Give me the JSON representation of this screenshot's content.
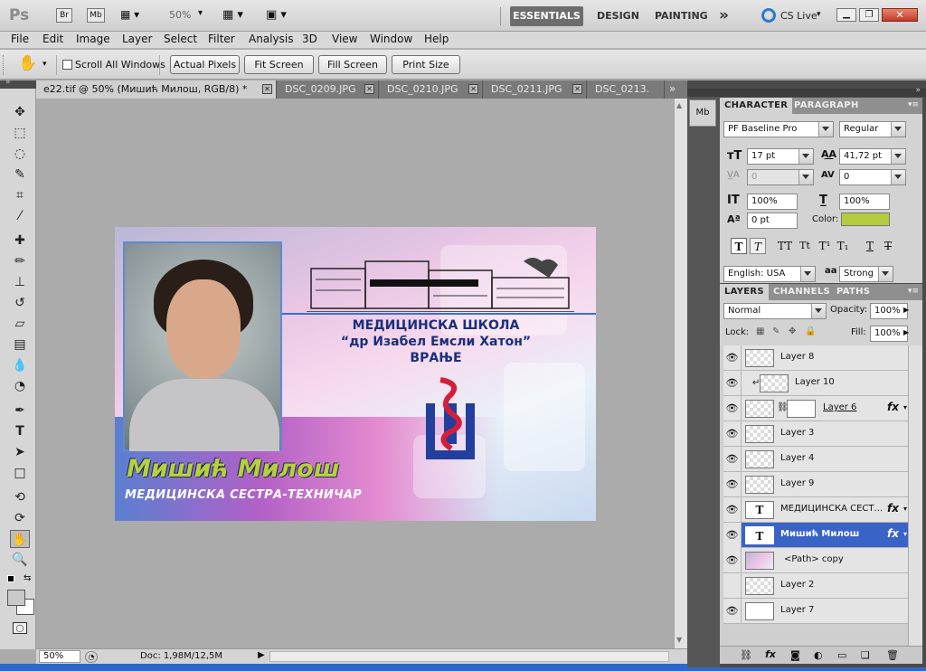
{
  "appbar": {
    "logo": "Ps",
    "bridge": "Br",
    "minibridge": "Mb",
    "zoom": "50%",
    "workspaces": [
      "ESSENTIALS",
      "DESIGN",
      "PAINTING"
    ],
    "more": "»",
    "cslive": "CS Live"
  },
  "menu": [
    "File",
    "Edit",
    "Image",
    "Layer",
    "Select",
    "Filter",
    "Analysis",
    "3D",
    "View",
    "Window",
    "Help"
  ],
  "options": {
    "scroll_all": "Scroll All Windows",
    "buttons": [
      "Actual Pixels",
      "Fit Screen",
      "Fill Screen",
      "Print Size"
    ]
  },
  "tabs": [
    "e22.tif @ 50% (Мишић Милош, RGB/8) *",
    "DSC_0209.JPG",
    "DSC_0210.JPG",
    "DSC_0211.JPG",
    "DSC_0213."
  ],
  "document": {
    "school_line1": "МЕДИЦИНСКА ШКОЛА",
    "school_line2": "“др Изабел Емсли Хатон”",
    "school_line3": "ВРАЊЕ",
    "name": "Мишић Милош",
    "role": "МЕДИЦИНСКА СЕСТРА-ТЕХНИЧАР"
  },
  "status": {
    "zoom": "50%",
    "doc": "Doc: 1,98M/12,5M"
  },
  "character": {
    "tabs": [
      "CHARACTER",
      "PARAGRAPH"
    ],
    "font": "PF Baseline Pro",
    "style": "Regular",
    "size": "17 pt",
    "leading": "41,72 pt",
    "kerning": "0",
    "tracking": "0",
    "vscale": "100%",
    "hscale": "100%",
    "baseline": "0 pt",
    "color_label": "Color:",
    "color": "#b5cc3f",
    "language": "English: USA",
    "aa_label": "aa",
    "antialias": "Strong",
    "type_buttons": [
      "T",
      "T",
      "TT",
      "Tt",
      "T¹",
      "T₁",
      "T",
      "T"
    ]
  },
  "layers": {
    "tabs": [
      "LAYERS",
      "CHANNELS",
      "PATHS"
    ],
    "blend": "Normal",
    "opacity_label": "Opacity:",
    "opacity": "100%",
    "lock_label": "Lock:",
    "fill_label": "Fill:",
    "fill": "100%",
    "items": [
      {
        "name": "Layer 8"
      },
      {
        "name": "Layer 10"
      },
      {
        "name": "Layer 6"
      },
      {
        "name": "Layer 3"
      },
      {
        "name": "Layer 4"
      },
      {
        "name": "Layer 9"
      },
      {
        "name": "МЕДИЦИНСКА СЕСТ..."
      },
      {
        "name": "Мишић Милош"
      },
      {
        "name": "<Path> copy"
      },
      {
        "name": "Layer 2"
      },
      {
        "name": "Layer 7"
      }
    ],
    "fx_label": "fx"
  }
}
